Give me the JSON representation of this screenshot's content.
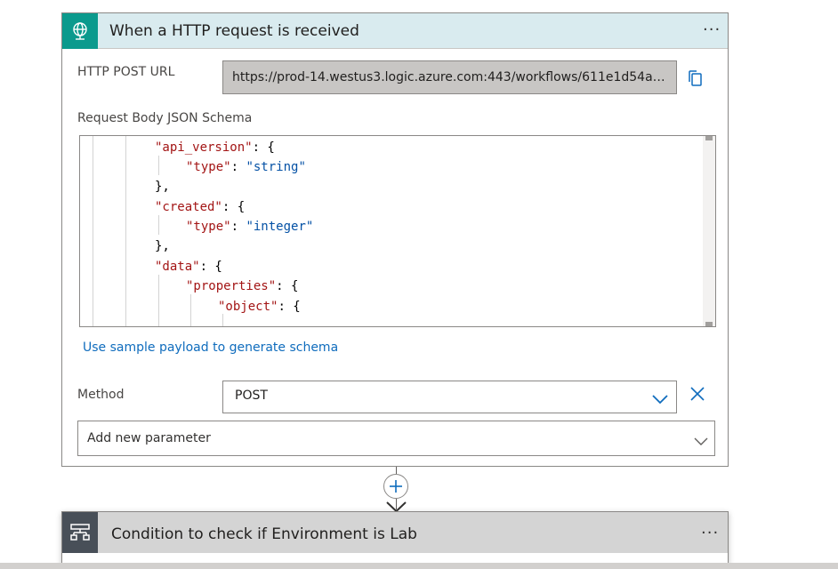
{
  "trigger": {
    "title": "When a HTTP request is received",
    "more_label": "···",
    "http_post_url_label": "HTTP POST URL",
    "http_post_url_value": "https://prod-14.westus3.logic.azure.com:443/workflows/611e1d54a4564...",
    "schema_label": "Request Body JSON Schema",
    "sample_payload_link": "Use sample payload to generate schema",
    "method_label": "Method",
    "method_value": "POST",
    "add_parameter_placeholder": "Add new parameter"
  },
  "schema_code": [
    {
      "key": "\"api_version\"",
      "rest": ": {"
    },
    {
      "key": "\"type\"",
      "colon": ": ",
      "str": "\"string\""
    },
    {
      "plain": "},"
    },
    {
      "key": "\"created\"",
      "rest": ": {"
    },
    {
      "key": "\"type\"",
      "colon": ": ",
      "str": "\"integer\""
    },
    {
      "plain": "},"
    },
    {
      "key": "\"data\"",
      "rest": ": {"
    },
    {
      "key": "\"properties\"",
      "rest": ": {"
    },
    {
      "key": "\"object\"",
      "rest": ": {"
    }
  ],
  "condition": {
    "title": "Condition to check if Environment is Lab",
    "more_label": "···"
  },
  "colors": {
    "trigger_header_bg": "#d9ebef",
    "trigger_icon_bg": "#0b9a8d",
    "link": "#0f6cbd",
    "condition_icon_bg": "#484f58"
  },
  "icons": {
    "trigger": "globe-request-icon",
    "copy": "copy-icon",
    "dropdown": "chevron-down-icon",
    "clear": "close-icon",
    "add": "plus-icon",
    "arrow": "arrow-down-icon",
    "condition": "condition-icon"
  }
}
